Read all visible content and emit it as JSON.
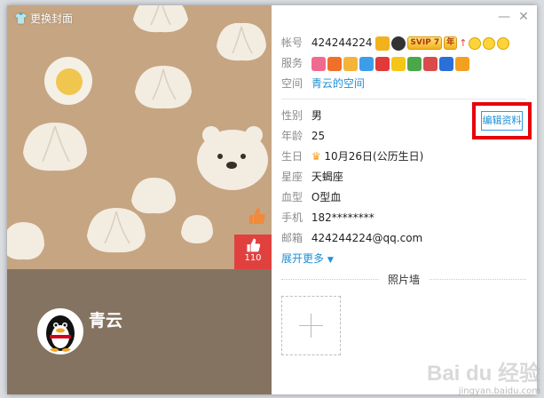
{
  "cover": {
    "change_cover_label": "更换封面",
    "like_count": "110",
    "nickname": "青云",
    "top_color": "#c6a583",
    "bottom_color": "#857361"
  },
  "window": {
    "minimize_glyph": "—",
    "close_glyph": "✕"
  },
  "account": {
    "label": "帐号",
    "value": "424244224",
    "svip_badge": "SVIP 7",
    "year_badge": "年"
  },
  "services": {
    "label": "服务",
    "icons": [
      "heart-icon",
      "flame-icon",
      "fish-icon",
      "gift-box-icon",
      "arrow-down-icon",
      "star-icon",
      "tree-icon",
      "pet-icon",
      "penguin-icon",
      "shield-icon"
    ]
  },
  "space": {
    "label": "空间",
    "link": "青云的空间"
  },
  "profile": {
    "gender_label": "性别",
    "gender": "男",
    "age_label": "年龄",
    "age": "25",
    "birthday_label": "生日",
    "birthday": "10月26日(公历生日)",
    "zodiac_label": "星座",
    "zodiac": "天蝎座",
    "blood_label": "血型",
    "blood": "O型血",
    "phone_label": "手机",
    "phone": "182********",
    "email_label": "邮箱",
    "email": "424244224@qq.com",
    "expand_more": "展开更多"
  },
  "edit_button": "编辑资料",
  "photo_wall": {
    "title": "照片墙"
  },
  "watermark": {
    "main": "Bai du 经验",
    "sub": "jingyan.baidu.com"
  },
  "colors": {
    "accent": "#1c8fd6",
    "highlight": "#e8000b",
    "like": "#e0413f"
  }
}
